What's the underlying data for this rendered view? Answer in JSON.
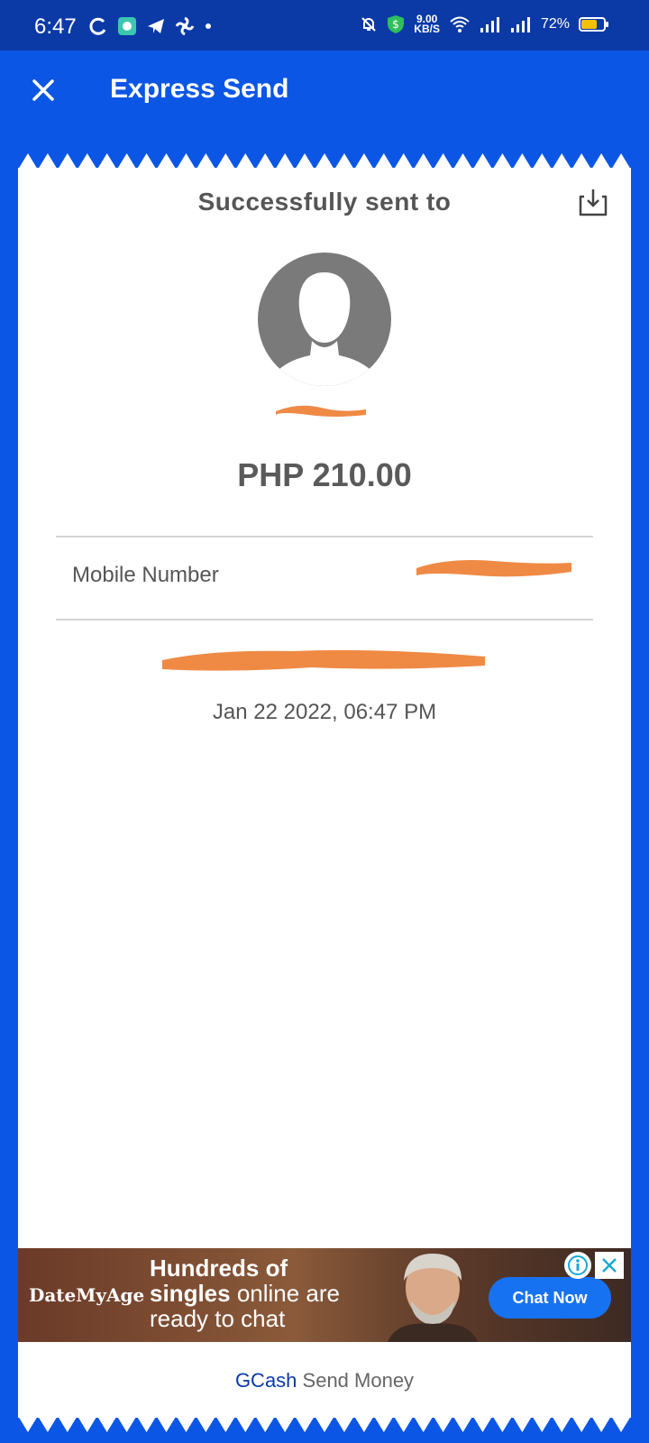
{
  "status_bar": {
    "time": "6:47",
    "speed_value": "9.00",
    "speed_unit": "KB/S",
    "battery": "72%",
    "battery_level": 0.72
  },
  "header": {
    "title": "Express Send"
  },
  "receipt": {
    "success_title": "Successfully sent to",
    "amount": "PHP 210.00",
    "mobile_label": "Mobile Number",
    "datetime": "Jan 22 2022, 06:47 PM"
  },
  "ad": {
    "brand": "DateMyAge",
    "line1": "Hundreds of",
    "line2_bold": "singles",
    "line2_light": " online are",
    "line3": "ready to chat",
    "cta": "Chat Now"
  },
  "footer": {
    "brand": "GCash",
    "text": " Send Money"
  },
  "colors": {
    "primary_blue": "#0b56e5",
    "status_blue": "#0b3aa6",
    "redaction_orange": "#ef8a45"
  }
}
